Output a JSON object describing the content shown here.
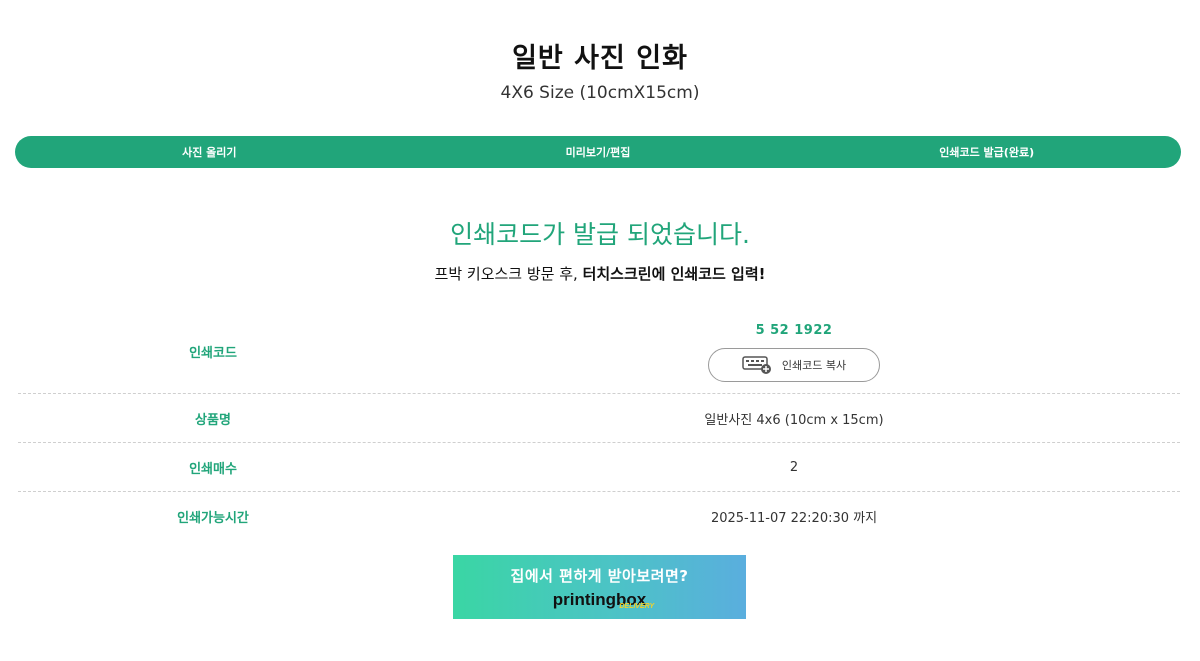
{
  "header": {
    "title": "일반 사진 인화",
    "subtitle": "4X6 Size (10cmX15cm)"
  },
  "steps": [
    {
      "label": "사진 올리기"
    },
    {
      "label": "미리보기/편집"
    },
    {
      "label": "인쇄코드 발급(완료)"
    }
  ],
  "status": {
    "message": "인쇄코드가 발급 되었습니다.",
    "instruction_prefix": "프박 키오스크 방문 후, ",
    "instruction_bold": "터치스크린에 인쇄코드 입력!"
  },
  "info": {
    "code_label": "인쇄코드",
    "code_value": "5 52 1922",
    "copy_button": "인쇄코드 복사",
    "product_label": "상품명",
    "product_value": "일반사진 4x6 (10cm x 15cm)",
    "count_label": "인쇄매수",
    "count_value": "2",
    "time_label": "인쇄가능시간",
    "time_value": "2025-11-07 22:20:30 까지"
  },
  "banner": {
    "headline": "집에서 편하게 받아보려면?",
    "brand": "printingbox",
    "brand_tag": "DELIVERY"
  },
  "colors": {
    "accent": "#21a57a",
    "banner_start": "#3ad6a4",
    "banner_end": "#5aaede"
  }
}
